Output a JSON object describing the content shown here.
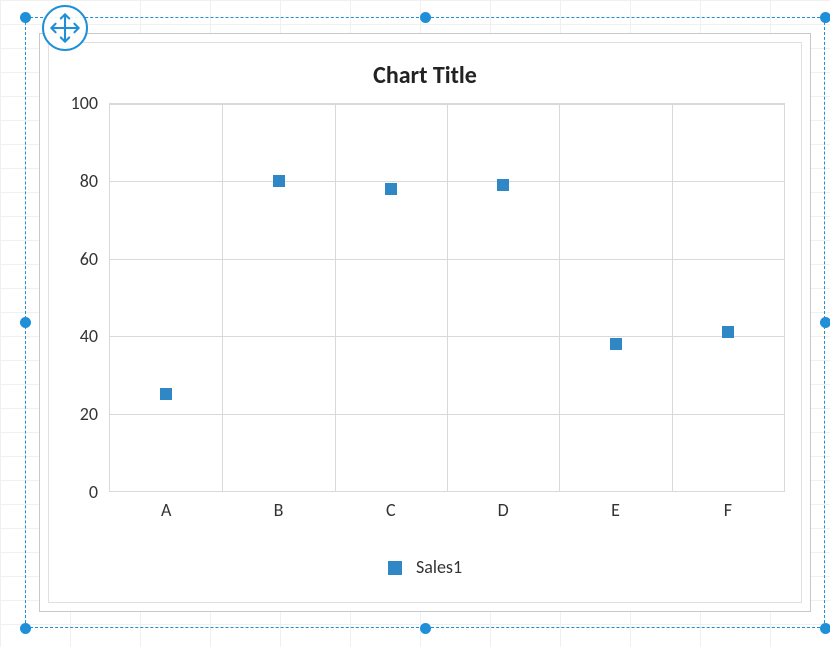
{
  "chart_data": {
    "type": "scatter",
    "title": "Chart Title",
    "xlabel": "",
    "ylabel": "",
    "categories": [
      "A",
      "B",
      "C",
      "D",
      "E",
      "F"
    ],
    "series": [
      {
        "name": "Sales1",
        "color": "#3087c6",
        "values": [
          25,
          80,
          78,
          79,
          38,
          41
        ]
      }
    ],
    "y_ticks": [
      0,
      20,
      40,
      60,
      80,
      100
    ],
    "ylim": [
      0,
      100
    ]
  },
  "legend": {
    "items": [
      {
        "label": "Sales1",
        "color": "#3087c6"
      }
    ]
  }
}
